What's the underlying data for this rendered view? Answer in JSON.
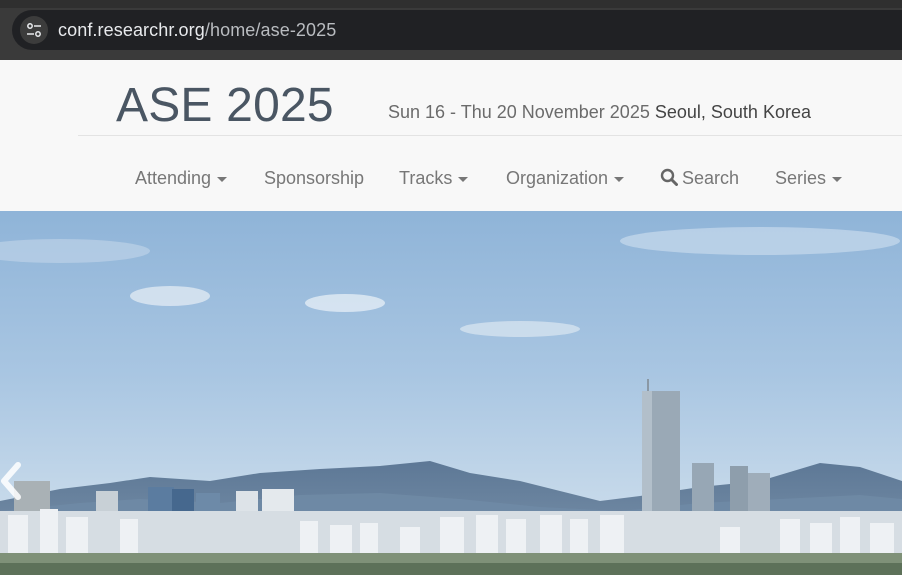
{
  "browser": {
    "url_host": "conf.researchr.org",
    "url_path": "/home/ase-2025",
    "site_info_icon": "tune-icon"
  },
  "header": {
    "title": "ASE 2025",
    "dates": "Sun 16 - Thu 20 November 2025",
    "location": "Seoul, South Korea"
  },
  "nav": {
    "attending": "Attending",
    "sponsorship": "Sponsorship",
    "tracks": "Tracks",
    "organization": "Organization",
    "search": "Search",
    "series": "Series"
  },
  "hero": {
    "image": "Seoul skyline panorama",
    "prev_icon": "chevron-left-icon"
  },
  "colors": {
    "title": "#4a5663",
    "nav_text": "#777777",
    "chrome_bg": "#202124"
  }
}
